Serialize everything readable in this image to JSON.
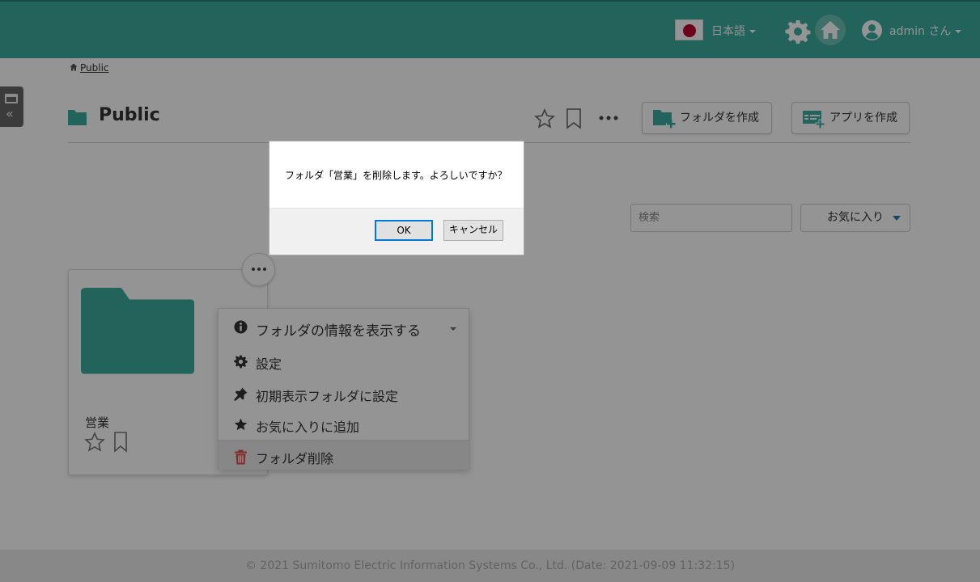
{
  "header": {
    "language": "日本語",
    "user_name": "admin さん"
  },
  "breadcrumb": {
    "label": "Public"
  },
  "page": {
    "title": "Public",
    "create_folder_label": "フォルダを作成",
    "create_app_label": "アプリを作成"
  },
  "search": {
    "placeholder": "検索"
  },
  "filter": {
    "selected": "お気に入り"
  },
  "folder_card": {
    "name": "営業"
  },
  "context_menu": {
    "items": [
      {
        "label": "フォルダの情報を表示する",
        "icon": "info-icon"
      },
      {
        "label": "設定",
        "icon": "gear-icon"
      },
      {
        "label": "初期表示フォルダに設定",
        "icon": "pin-icon"
      },
      {
        "label": "お気に入りに追加",
        "icon": "star-icon"
      },
      {
        "label": "フォルダ削除",
        "icon": "trash-icon"
      }
    ]
  },
  "dialog": {
    "message": "フォルダ「営業」を削除します。よろしいですか？",
    "ok_label": "OK",
    "cancel_label": "キャンセル"
  },
  "footer": {
    "text": "© 2021 Sumitomo Electric Information Systems Co., Ltd. (Date: 2021-09-09 11:32:15)"
  },
  "colors": {
    "brand_teal": "#3cab9e",
    "delete_red": "#d9534f",
    "dialog_focus_blue": "#0078d7"
  }
}
